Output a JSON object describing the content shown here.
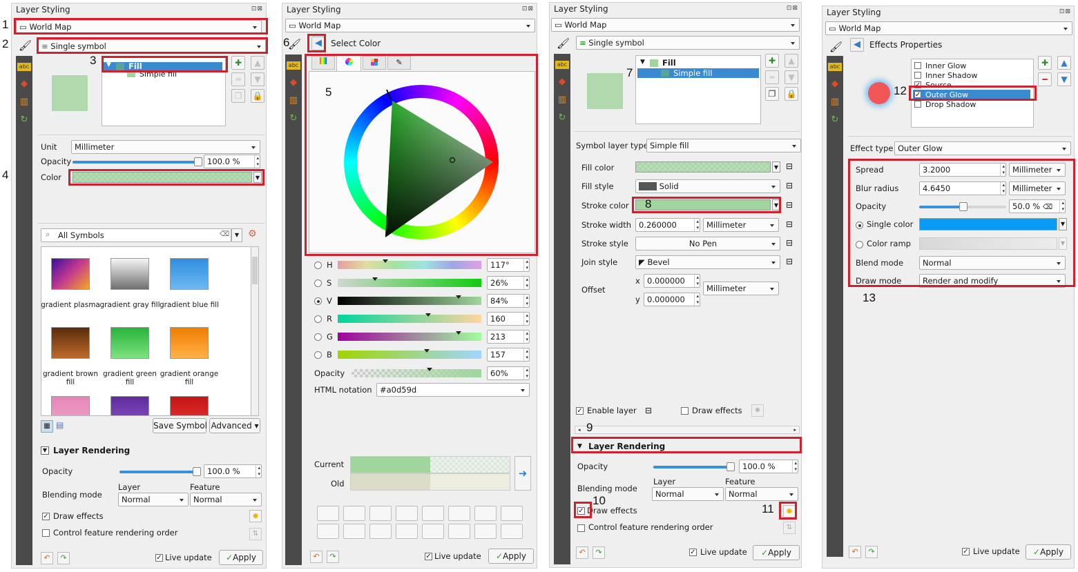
{
  "title": "Layer Styling",
  "win_buttons": "⊡⊠",
  "layer_name": "World Map",
  "renderer": "Single symbol",
  "colors": {
    "accent_red": "#d0202e",
    "selection_blue": "#3a8ad2",
    "fill_green": "#a0d59d",
    "outer_glow": "#f03f3f",
    "single_color": "#0a9cf5"
  },
  "annotations": [
    "1",
    "2",
    "3",
    "4",
    "5",
    "6",
    "7",
    "8",
    "9",
    "10",
    "11",
    "12",
    "13"
  ],
  "panel1": {
    "tree": {
      "fill": "Fill",
      "simple_fill": "Simple fill"
    },
    "unit_label": "Unit",
    "unit_value": "Millimeter",
    "opacity_label": "Opacity",
    "opacity_value": "100.0 %",
    "color_label": "Color",
    "symbols_search": "All Symbols",
    "symbols": [
      {
        "name": "gradient plasma",
        "grad": "linear-gradient(135deg,#3b0f9c,#c53a8e,#f5a623)"
      },
      {
        "name": "gradient  gray fill",
        "grad": "linear-gradient(180deg,#f5f5f5,#6f6f6f)"
      },
      {
        "name": "gradient blue fill",
        "grad": "linear-gradient(180deg,#2f8fe0,#6db8f2)"
      },
      {
        "name": "gradient brown fill",
        "grad": "linear-gradient(180deg,#5a2c0d,#c0692a)"
      },
      {
        "name": "gradient green fill",
        "grad": "linear-gradient(180deg,#26b43b,#7ee27e)"
      },
      {
        "name": "gradient orange fill",
        "grad": "linear-gradient(180deg,#f07d00,#ffb14a)"
      },
      {
        "name": "",
        "grad": "linear-gradient(180deg,#e685b7,#f0a5cc)"
      },
      {
        "name": "",
        "grad": "linear-gradient(180deg,#5e2ca0,#8a52c0)"
      },
      {
        "name": "",
        "grad": "linear-gradient(180deg,#c41414,#e53535)"
      }
    ],
    "save_symbol": "Save Symbol",
    "advanced": "Advanced",
    "layer_rendering": "Layer Rendering",
    "lr_opacity_label": "Opacity",
    "lr_opacity_value": "100.0 %",
    "blending_label": "Blending mode",
    "layer_col": "Layer",
    "feature_col": "Feature",
    "blend_layer": "Normal",
    "blend_feature": "Normal",
    "draw_effects": "Draw effects",
    "control_order": "Control feature rendering order",
    "live_update": "Live update",
    "apply": "Apply"
  },
  "panel2": {
    "select_color": "Select Color",
    "channels": [
      {
        "label": "H",
        "value": "117°",
        "pos": 0.33
      },
      {
        "label": "S",
        "value": "26%",
        "pos": 0.26
      },
      {
        "label": "V",
        "value": "84%",
        "pos": 0.84
      },
      {
        "label": "R",
        "value": "160",
        "pos": 0.63
      },
      {
        "label": "G",
        "value": "213",
        "pos": 0.84
      },
      {
        "label": "B",
        "value": "157",
        "pos": 0.62
      }
    ],
    "opacity_label": "Opacity",
    "opacity_value": "60%",
    "opacity_pos": 0.6,
    "html_label": "HTML notation",
    "html_value": "#a0d59d",
    "current": "Current",
    "old": "Old",
    "live_update": "Live update",
    "apply": "Apply"
  },
  "panel3": {
    "tree": {
      "fill": "Fill",
      "simple_fill": "Simple fill"
    },
    "symbol_layer_type_label": "Symbol layer type",
    "symbol_layer_type": "Simple fill",
    "fill_color_label": "Fill color",
    "fill_style_label": "Fill style",
    "fill_style": "Solid",
    "stroke_color_label": "Stroke color",
    "stroke_width_label": "Stroke width",
    "stroke_width": "0.260000",
    "stroke_unit": "Millimeter",
    "stroke_style_label": "Stroke style",
    "stroke_style": "No Pen",
    "join_style_label": "Join style",
    "join_style": "Bevel",
    "offset_label": "Offset",
    "offset_x_label": "x",
    "offset_x": "0.000000",
    "offset_y_label": "y",
    "offset_y": "0.000000",
    "offset_unit": "Millimeter",
    "enable_layer": "Enable layer",
    "draw_effects_top": "Draw effects",
    "layer_rendering": "Layer Rendering",
    "lr_opacity_label": "Opacity",
    "lr_opacity_value": "100.0 %",
    "blending_label": "Blending mode",
    "layer_col": "Layer",
    "feature_col": "Feature",
    "blend_layer": "Normal",
    "blend_feature": "Normal",
    "draw_effects": "Draw effects",
    "control_order": "Control feature rendering order",
    "live_update": "Live update",
    "apply": "Apply"
  },
  "panel4": {
    "effects_properties": "Effects Properties",
    "effects": [
      "Inner Glow",
      "Inner Shadow",
      "Source",
      "Outer Glow",
      "Drop Shadow"
    ],
    "effect_type_label": "Effect type",
    "effect_type": "Outer Glow",
    "spread_label": "Spread",
    "spread": "3.2000",
    "spread_unit": "Millimeter",
    "blur_label": "Blur radius",
    "blur": "4.6450",
    "blur_unit": "Millimeter",
    "opacity_label": "Opacity",
    "opacity_value": "50.0 %",
    "single_color_label": "Single color",
    "color_ramp_label": "Color ramp",
    "blend_label": "Blend mode",
    "blend_value": "Normal",
    "draw_mode_label": "Draw mode",
    "draw_mode": "Render and modify",
    "live_update": "Live update",
    "apply": "Apply"
  }
}
